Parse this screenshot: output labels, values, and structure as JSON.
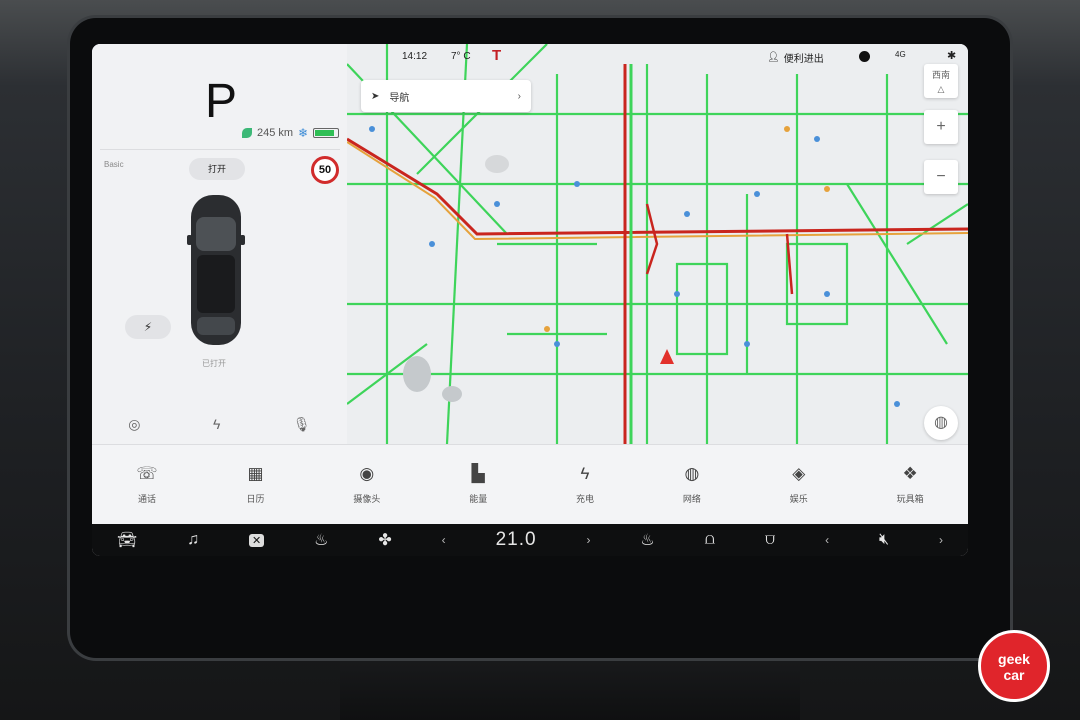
{
  "status": {
    "time": "14:12",
    "temperature": "7° C",
    "user": "便利进出",
    "network": "4G"
  },
  "vehicle": {
    "gear": "P",
    "range": "245 km",
    "mode": "Basic",
    "open_button": "打开",
    "speed_limit": "50",
    "trunk_label": "已打开",
    "battery_level": 0.85
  },
  "map": {
    "nav_label": "导航",
    "compass": "西南"
  },
  "dock": [
    {
      "icon": "phone-icon",
      "label": "通话"
    },
    {
      "icon": "calendar-icon",
      "label": "日历"
    },
    {
      "icon": "camera-icon",
      "label": "摄像头"
    },
    {
      "icon": "energy-icon",
      "label": "能量"
    },
    {
      "icon": "charge-icon",
      "label": "充电"
    },
    {
      "icon": "globe-icon",
      "label": "网络"
    },
    {
      "icon": "game-icon",
      "label": "娱乐"
    },
    {
      "icon": "toybox-icon",
      "label": "玩具箱"
    }
  ],
  "climate": {
    "temperature": "21.0"
  },
  "watermark": {
    "line1": "geek",
    "line2": "car"
  },
  "colors": {
    "accent": "#d12b2b",
    "traffic_green": "#3ed45a",
    "traffic_red": "#c9251e",
    "battery": "#2fbf55"
  }
}
